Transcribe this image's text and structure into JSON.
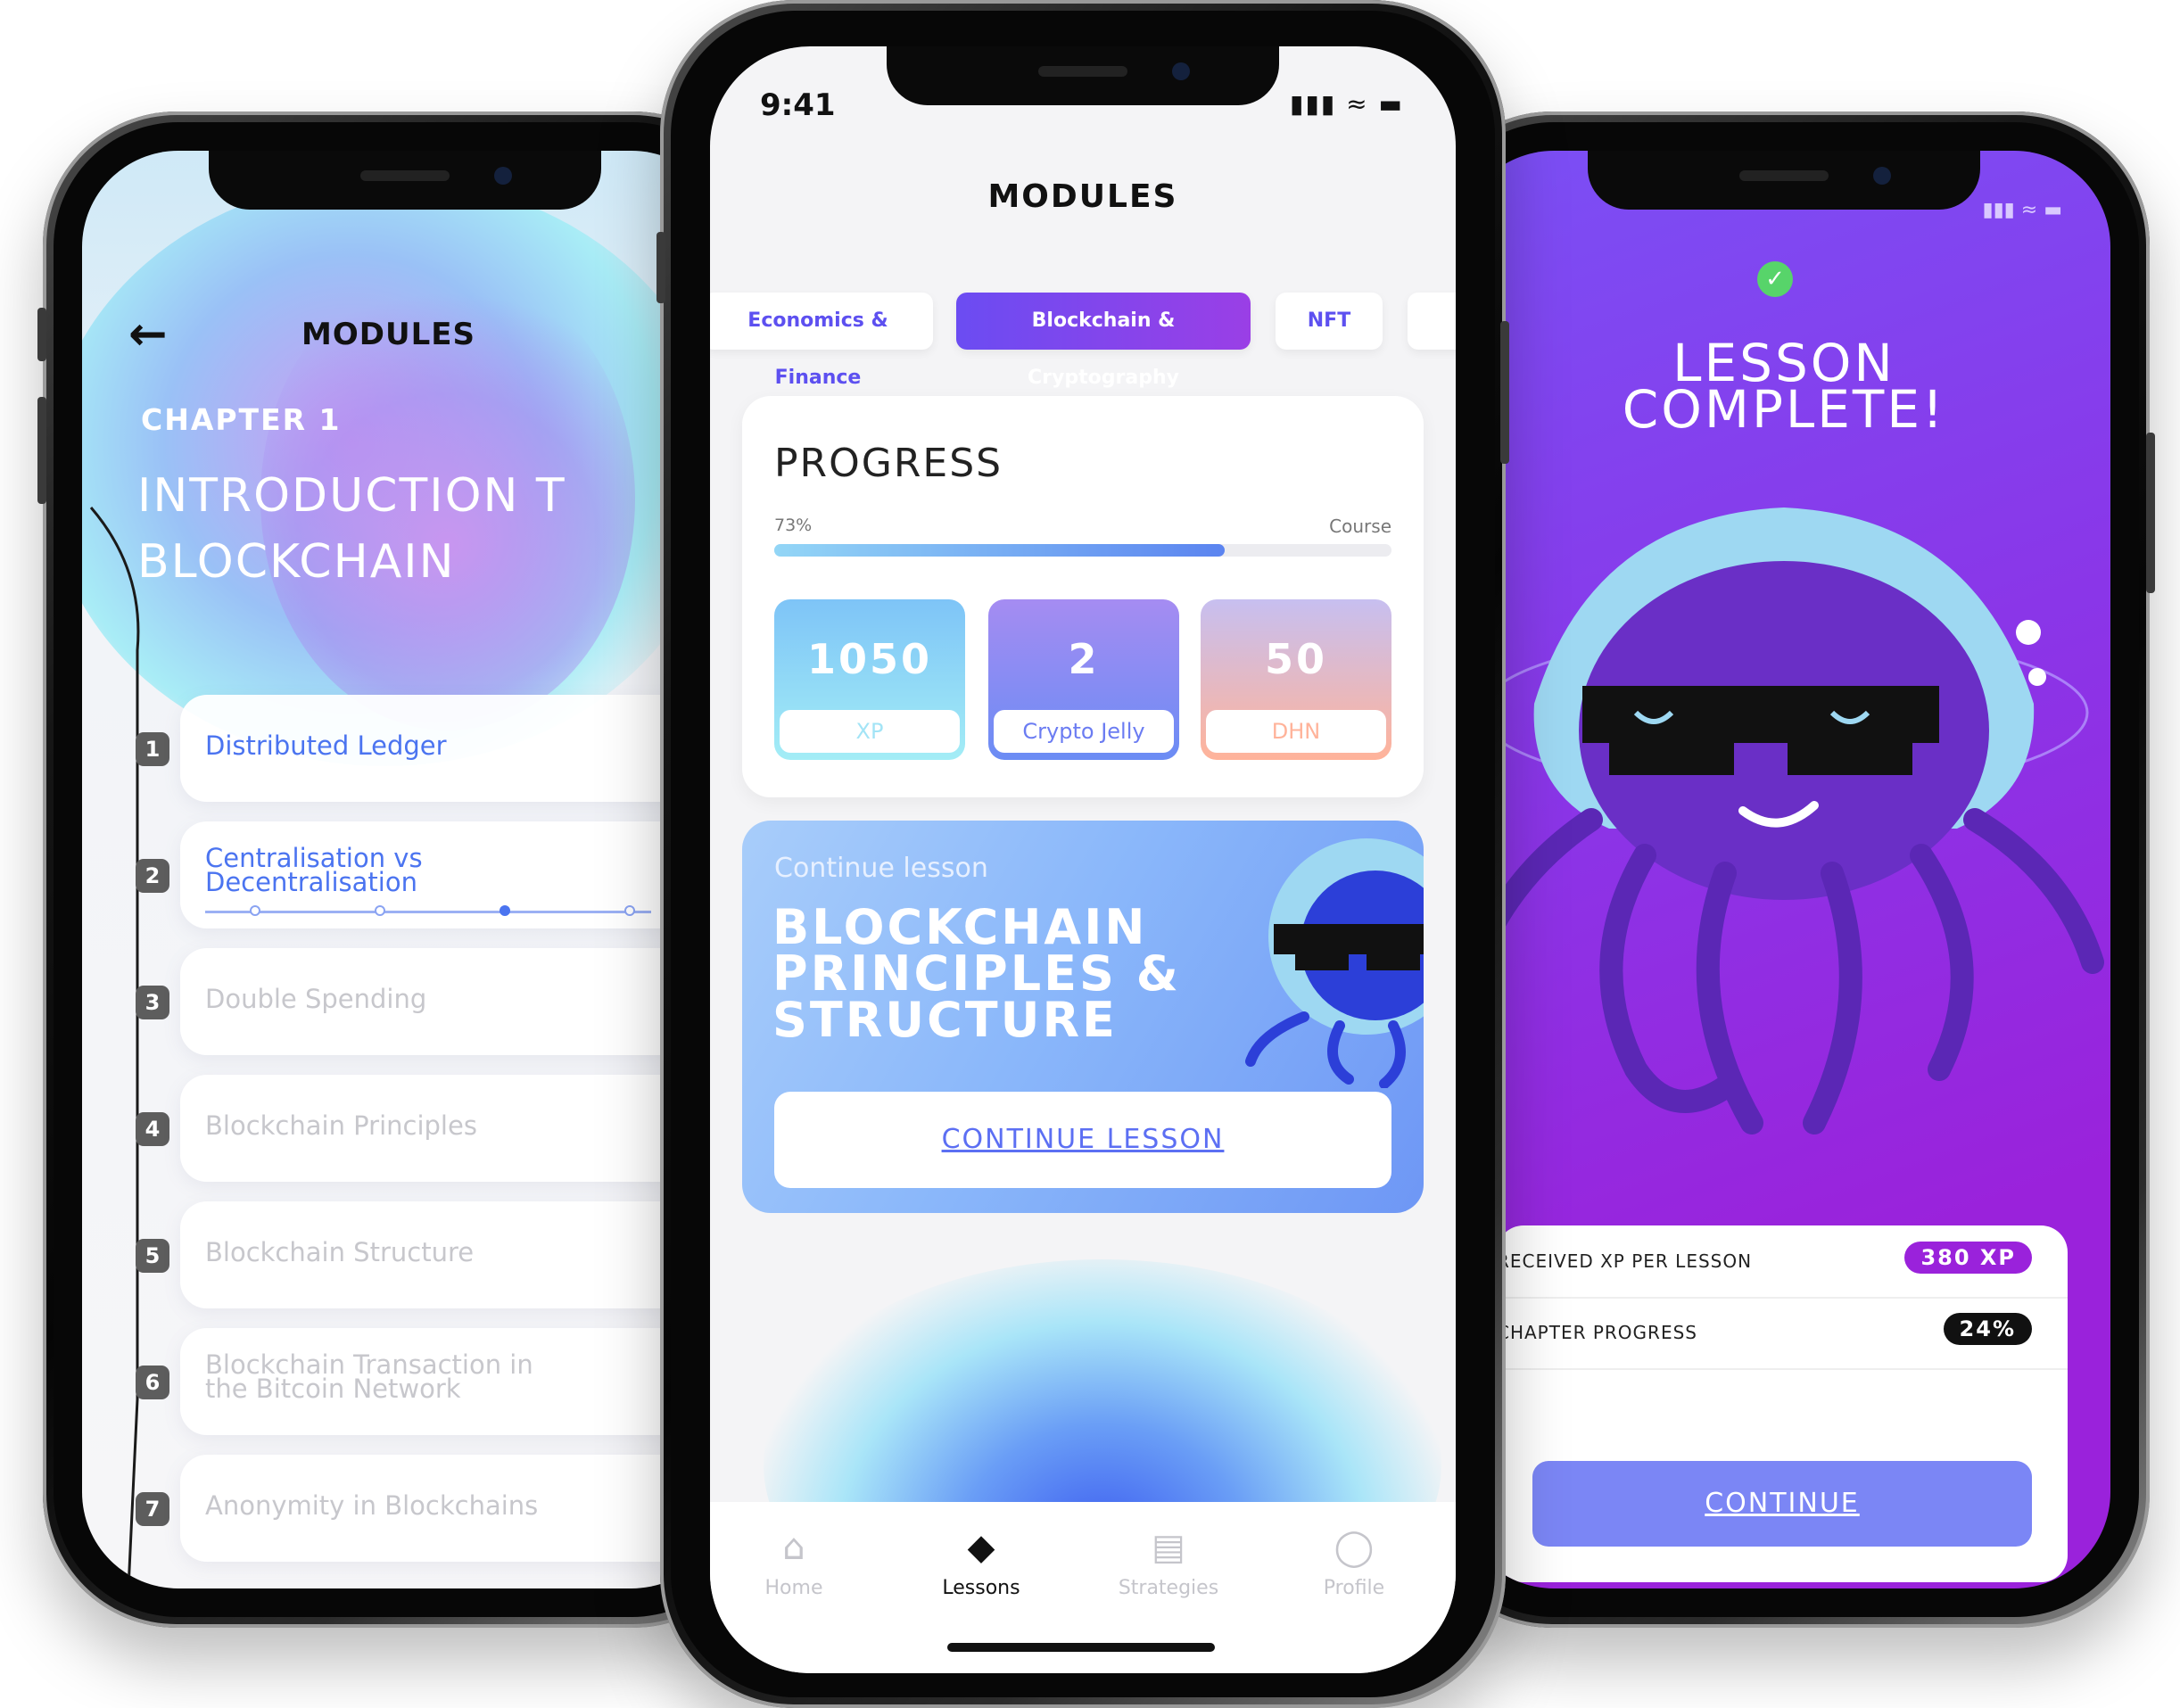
{
  "left_screen": {
    "header": {
      "title": "MODULES",
      "back_icon": "back-arrow-icon"
    },
    "chapter": "CHAPTER 1",
    "heading": "INTRODUCTION T\nBLOCKCHAIN",
    "lessons": [
      {
        "num": "1",
        "title": "Distributed Ledger"
      },
      {
        "num": "2",
        "title": "Centralisation vs\nDecentralisation"
      },
      {
        "num": "3",
        "title": "Double Spending"
      },
      {
        "num": "4",
        "title": "Blockchain Principles"
      },
      {
        "num": "5",
        "title": "Blockchain Structure"
      },
      {
        "num": "6",
        "title": "Blockchain Transaction in\nthe Bitcoin Network"
      },
      {
        "num": "7",
        "title": "Anonymity in Blockchains"
      }
    ]
  },
  "center_screen": {
    "status": {
      "time": "9:41",
      "icons": "signal-wifi-battery"
    },
    "title": "MODULES",
    "categories": [
      "Economics & Finance",
      "Blockchain & Cryptography",
      "NFT"
    ],
    "progress": {
      "heading": "PROGRESS",
      "percent_label": "73%",
      "percent_value": 0.73,
      "course_label": "Course",
      "stats": [
        {
          "value": "1050",
          "label": "XP"
        },
        {
          "value": "2",
          "label": "Crypto Jelly"
        },
        {
          "value": "50",
          "label": "DHN"
        }
      ]
    },
    "continue_card": {
      "subtitle": "Continue lesson",
      "title": "BLOCKCHAIN\nPRINCIPLES &\nSTRUCTURE",
      "button": "CONTINUE LESSON"
    },
    "tabbar": [
      {
        "label": "Home",
        "icon": "home-icon"
      },
      {
        "label": "Lessons",
        "icon": "graduation-cap-icon"
      },
      {
        "label": "Strategies",
        "icon": "chart-icon"
      },
      {
        "label": "Profile",
        "icon": "user-icon"
      }
    ]
  },
  "right_screen": {
    "title": "LESSON\nCOMPLETE!",
    "rows": [
      {
        "label": "RECEIVED XP PER LESSON",
        "value": "380 XP"
      },
      {
        "label": "CHAPTER PROGRESS",
        "value": "24%"
      }
    ],
    "button": "CONTINUE"
  },
  "colors": {
    "accent_blue": "#4b74f0",
    "accent_purple": "#8a36e8",
    "xp_badge": "#9a22db"
  }
}
